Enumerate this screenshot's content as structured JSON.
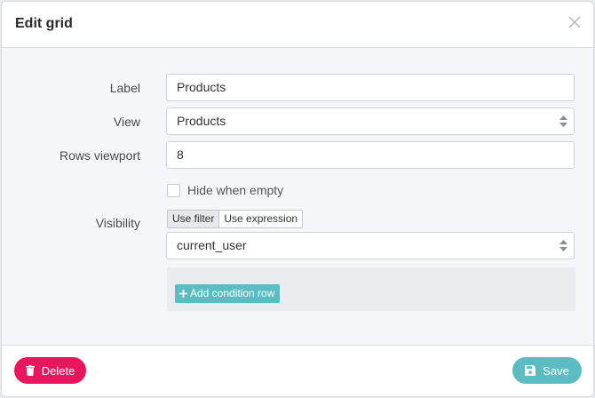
{
  "modal": {
    "title": "Edit grid",
    "close_icon": "close-icon"
  },
  "form": {
    "label": {
      "caption": "Label",
      "value": "Products"
    },
    "view": {
      "caption": "View",
      "value": "Products"
    },
    "rows_viewport": {
      "caption": "Rows viewport",
      "value": "8"
    },
    "hide_when_empty": {
      "caption": "Hide when empty",
      "checked": false
    },
    "visibility": {
      "caption": "Visibility",
      "modes": [
        "Use filter",
        "Use expression"
      ],
      "active_mode": "Use filter",
      "filter_value": "current_user",
      "add_condition_label": "Add condition row"
    }
  },
  "footer": {
    "delete_label": "Delete",
    "save_label": "Save"
  },
  "colors": {
    "danger": "#e8175d",
    "primary": "#5bbcc2"
  }
}
